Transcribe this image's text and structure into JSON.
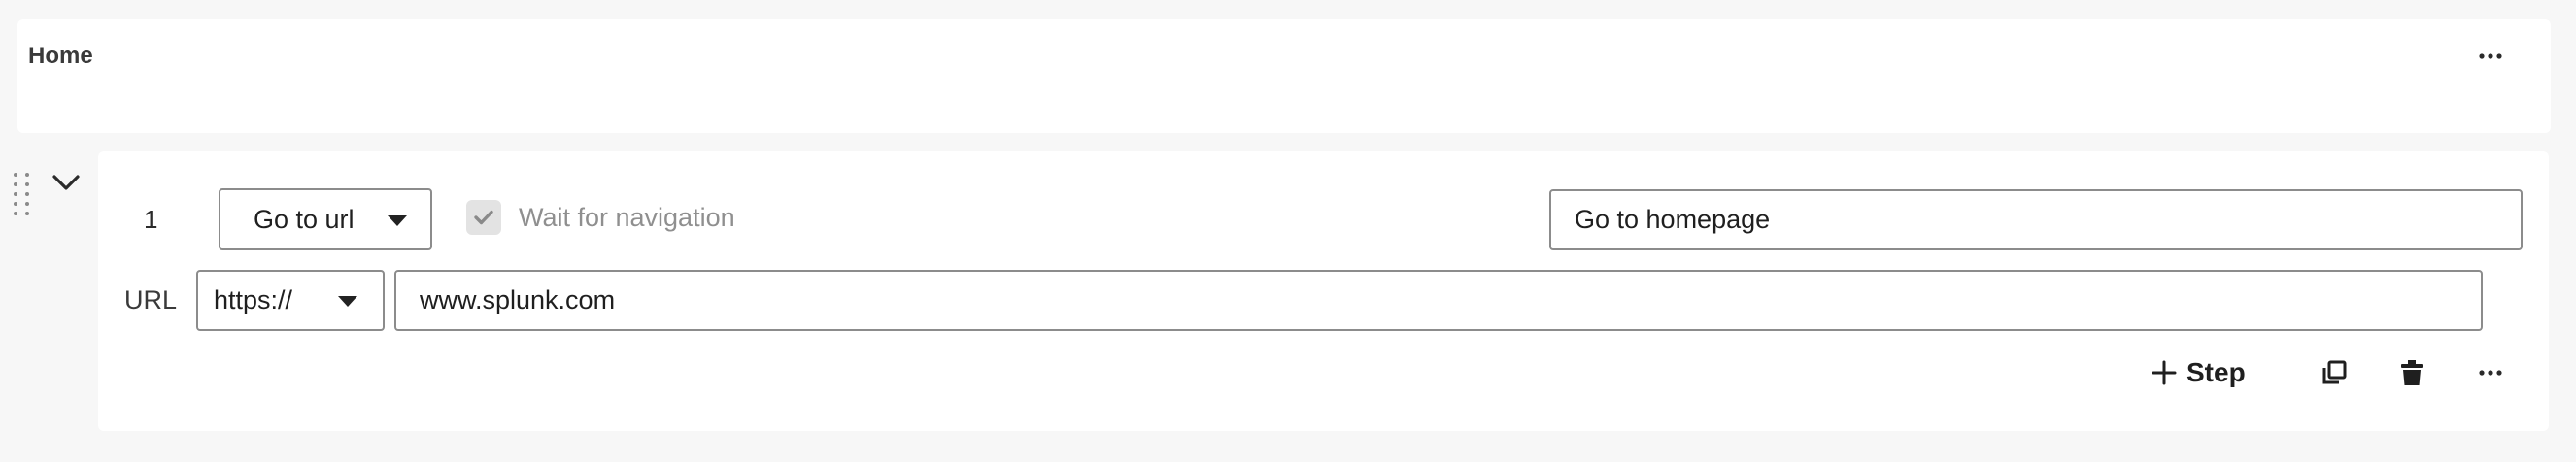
{
  "section": {
    "title": "Home",
    "more_icon": "more-horizontal-icon"
  },
  "step": {
    "number": "1",
    "action": {
      "value": "Go to url",
      "icon": "caret-down-icon"
    },
    "wait_for_navigation": {
      "label": "Wait for navigation",
      "checked": true
    },
    "name_value": "Go to homepage",
    "url_label": "URL",
    "protocol": {
      "value": "https://",
      "icon": "caret-down-icon"
    },
    "url_value": "www.splunk.com",
    "add_step_label": "Step",
    "icons": {
      "drag": "drag-handle-icon",
      "collapse": "chevron-down-icon",
      "add": "plus-icon",
      "duplicate": "duplicate-icon",
      "delete": "trash-icon",
      "more": "more-horizontal-icon"
    }
  },
  "colors": {
    "page_background": "#f7f7f7",
    "card_background": "#ffffff",
    "border": "#8c8c8c",
    "muted_text": "#8f8f8f",
    "checkbox_background": "#e3e3e3"
  }
}
